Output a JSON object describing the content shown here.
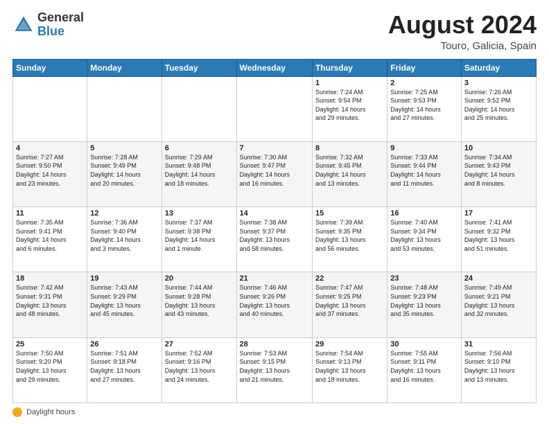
{
  "header": {
    "logo_general": "General",
    "logo_blue": "Blue",
    "title": "August 2024",
    "location": "Touro, Galicia, Spain"
  },
  "footer": {
    "daylight_label": "Daylight hours"
  },
  "weekdays": [
    "Sunday",
    "Monday",
    "Tuesday",
    "Wednesday",
    "Thursday",
    "Friday",
    "Saturday"
  ],
  "weeks": [
    [
      {
        "day": "",
        "info": ""
      },
      {
        "day": "",
        "info": ""
      },
      {
        "day": "",
        "info": ""
      },
      {
        "day": "",
        "info": ""
      },
      {
        "day": "1",
        "info": "Sunrise: 7:24 AM\nSunset: 9:54 PM\nDaylight: 14 hours\nand 29 minutes."
      },
      {
        "day": "2",
        "info": "Sunrise: 7:25 AM\nSunset: 9:53 PM\nDaylight: 14 hours\nand 27 minutes."
      },
      {
        "day": "3",
        "info": "Sunrise: 7:26 AM\nSunset: 9:52 PM\nDaylight: 14 hours\nand 25 minutes."
      }
    ],
    [
      {
        "day": "4",
        "info": "Sunrise: 7:27 AM\nSunset: 9:50 PM\nDaylight: 14 hours\nand 23 minutes."
      },
      {
        "day": "5",
        "info": "Sunrise: 7:28 AM\nSunset: 9:49 PM\nDaylight: 14 hours\nand 20 minutes."
      },
      {
        "day": "6",
        "info": "Sunrise: 7:29 AM\nSunset: 9:48 PM\nDaylight: 14 hours\nand 18 minutes."
      },
      {
        "day": "7",
        "info": "Sunrise: 7:30 AM\nSunset: 9:47 PM\nDaylight: 14 hours\nand 16 minutes."
      },
      {
        "day": "8",
        "info": "Sunrise: 7:32 AM\nSunset: 9:45 PM\nDaylight: 14 hours\nand 13 minutes."
      },
      {
        "day": "9",
        "info": "Sunrise: 7:33 AM\nSunset: 9:44 PM\nDaylight: 14 hours\nand 11 minutes."
      },
      {
        "day": "10",
        "info": "Sunrise: 7:34 AM\nSunset: 9:43 PM\nDaylight: 14 hours\nand 8 minutes."
      }
    ],
    [
      {
        "day": "11",
        "info": "Sunrise: 7:35 AM\nSunset: 9:41 PM\nDaylight: 14 hours\nand 6 minutes."
      },
      {
        "day": "12",
        "info": "Sunrise: 7:36 AM\nSunset: 9:40 PM\nDaylight: 14 hours\nand 3 minutes."
      },
      {
        "day": "13",
        "info": "Sunrise: 7:37 AM\nSunset: 9:38 PM\nDaylight: 14 hours\nand 1 minute."
      },
      {
        "day": "14",
        "info": "Sunrise: 7:38 AM\nSunset: 9:37 PM\nDaylight: 13 hours\nand 58 minutes."
      },
      {
        "day": "15",
        "info": "Sunrise: 7:39 AM\nSunset: 9:35 PM\nDaylight: 13 hours\nand 56 minutes."
      },
      {
        "day": "16",
        "info": "Sunrise: 7:40 AM\nSunset: 9:34 PM\nDaylight: 13 hours\nand 53 minutes."
      },
      {
        "day": "17",
        "info": "Sunrise: 7:41 AM\nSunset: 9:32 PM\nDaylight: 13 hours\nand 51 minutes."
      }
    ],
    [
      {
        "day": "18",
        "info": "Sunrise: 7:42 AM\nSunset: 9:31 PM\nDaylight: 13 hours\nand 48 minutes."
      },
      {
        "day": "19",
        "info": "Sunrise: 7:43 AM\nSunset: 9:29 PM\nDaylight: 13 hours\nand 45 minutes."
      },
      {
        "day": "20",
        "info": "Sunrise: 7:44 AM\nSunset: 9:28 PM\nDaylight: 13 hours\nand 43 minutes."
      },
      {
        "day": "21",
        "info": "Sunrise: 7:46 AM\nSunset: 9:26 PM\nDaylight: 13 hours\nand 40 minutes."
      },
      {
        "day": "22",
        "info": "Sunrise: 7:47 AM\nSunset: 9:25 PM\nDaylight: 13 hours\nand 37 minutes."
      },
      {
        "day": "23",
        "info": "Sunrise: 7:48 AM\nSunset: 9:23 PM\nDaylight: 13 hours\nand 35 minutes."
      },
      {
        "day": "24",
        "info": "Sunrise: 7:49 AM\nSunset: 9:21 PM\nDaylight: 13 hours\nand 32 minutes."
      }
    ],
    [
      {
        "day": "25",
        "info": "Sunrise: 7:50 AM\nSunset: 9:20 PM\nDaylight: 13 hours\nand 29 minutes."
      },
      {
        "day": "26",
        "info": "Sunrise: 7:51 AM\nSunset: 9:18 PM\nDaylight: 13 hours\nand 27 minutes."
      },
      {
        "day": "27",
        "info": "Sunrise: 7:52 AM\nSunset: 9:16 PM\nDaylight: 13 hours\nand 24 minutes."
      },
      {
        "day": "28",
        "info": "Sunrise: 7:53 AM\nSunset: 9:15 PM\nDaylight: 13 hours\nand 21 minutes."
      },
      {
        "day": "29",
        "info": "Sunrise: 7:54 AM\nSunset: 9:13 PM\nDaylight: 13 hours\nand 18 minutes."
      },
      {
        "day": "30",
        "info": "Sunrise: 7:55 AM\nSunset: 9:11 PM\nDaylight: 13 hours\nand 16 minutes."
      },
      {
        "day": "31",
        "info": "Sunrise: 7:56 AM\nSunset: 9:10 PM\nDaylight: 13 hours\nand 13 minutes."
      }
    ]
  ]
}
